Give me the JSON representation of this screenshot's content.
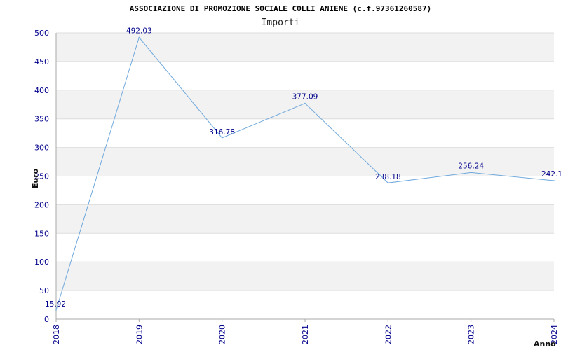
{
  "header": {
    "title": "ASSOCIAZIONE DI PROMOZIONE SOCIALE COLLI ANIENE (c.f.97361260587)",
    "subtitle": "Importi"
  },
  "chart_data": {
    "type": "line",
    "title": "ASSOCIAZIONE DI PROMOZIONE SOCIALE COLLI ANIENE (c.f.97361260587)",
    "subtitle": "Importi",
    "xlabel": "Anno",
    "ylabel": "Euro",
    "categories": [
      "2018",
      "2019",
      "2020",
      "2021",
      "2022",
      "2023",
      "2024"
    ],
    "values": [
      15.92,
      492.03,
      316.78,
      377.09,
      238.18,
      256.24,
      242.1
    ],
    "data_labels": [
      "15.92",
      "492.03",
      "316.78",
      "377.09",
      "238.18",
      "256.24",
      "242.1"
    ],
    "ylim": [
      0,
      500
    ],
    "yticks": [
      0,
      50,
      100,
      150,
      200,
      250,
      300,
      350,
      400,
      450,
      500
    ],
    "grid": "horizontal, alternating bands",
    "colors": {
      "line": "#6fa8dc",
      "band": "#f2f2f2",
      "grid": "#dddddd",
      "tick_text": "#00008b",
      "axis": "#aaaaaa"
    }
  }
}
